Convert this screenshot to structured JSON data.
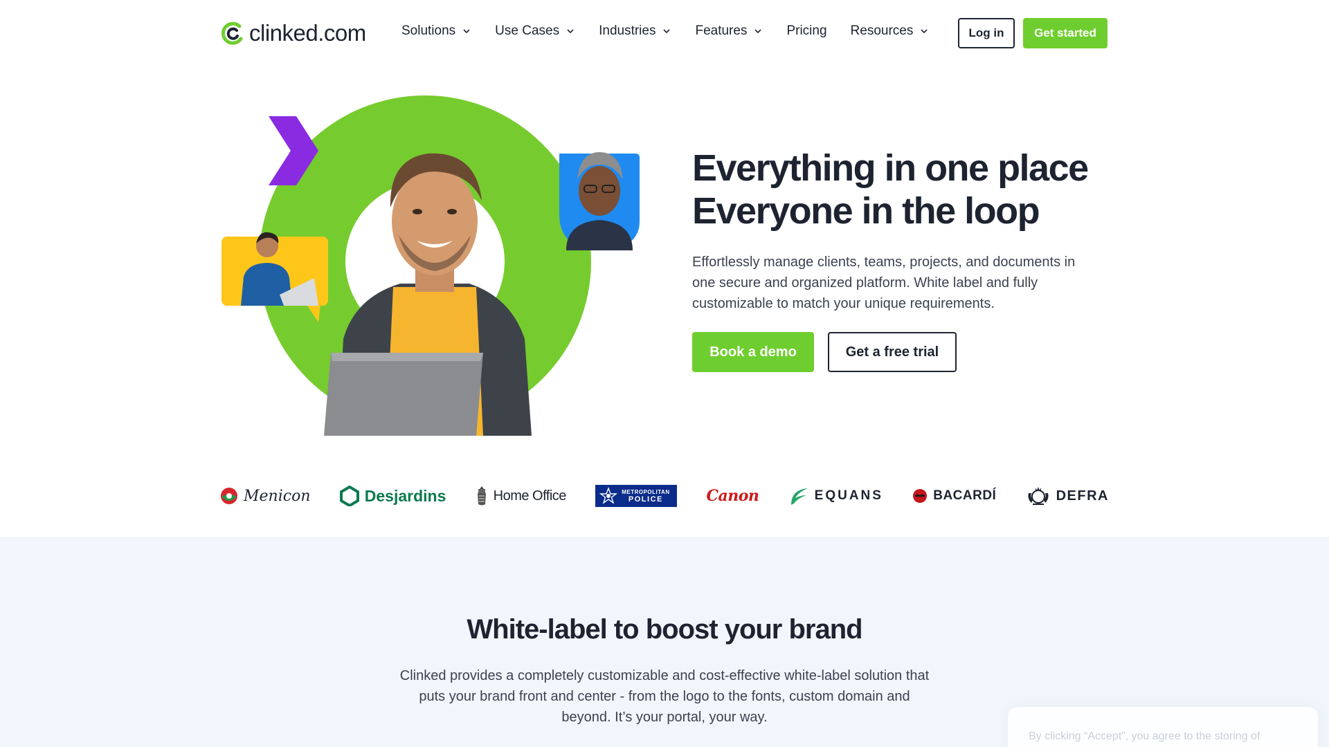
{
  "header": {
    "logo_text": "clinked.com",
    "nav": [
      {
        "label": "Solutions",
        "has_dropdown": true
      },
      {
        "label": "Use Cases",
        "has_dropdown": true
      },
      {
        "label": "Industries",
        "has_dropdown": true
      },
      {
        "label": "Features",
        "has_dropdown": true
      },
      {
        "label": "Pricing",
        "has_dropdown": false
      },
      {
        "label": "Resources",
        "has_dropdown": true
      }
    ],
    "login_label": "Log in",
    "get_started_label": "Get started"
  },
  "hero": {
    "title_line1": "Everything in one place",
    "title_line2": "Everyone in the loop",
    "description": "Effortlessly manage clients, teams, projects, and documents in one secure and organized platform. White label and fully customizable to match your unique requirements.",
    "book_demo_label": "Book a demo",
    "free_trial_label": "Get a free trial"
  },
  "client_logos": {
    "menicon": "Menicon",
    "desjardins": "Desjardins",
    "home_office": "Home Office",
    "met_police_line1": "METROPOLITAN",
    "met_police_line2": "POLICE",
    "canon": "Canon",
    "equans": "EQUANS",
    "bacardi": "BACARDÍ",
    "defra": "DEFRA"
  },
  "section2": {
    "title": "White-label to boost your brand",
    "description": "Clinked provides a completely customizable and cost-effective white-label solution that puts your brand front and center - from the logo to the fonts, custom domain and beyond. It’s your portal, your way."
  },
  "cookie_banner": {
    "text": "By clicking “Accept”, you agree to the storing of"
  },
  "colors": {
    "brand_green": "#6fce2f",
    "purple_accent": "#8a2be2",
    "blue_accent": "#1f8bf0",
    "yellow_accent": "#ffc61a",
    "text_dark": "#1d2330"
  }
}
